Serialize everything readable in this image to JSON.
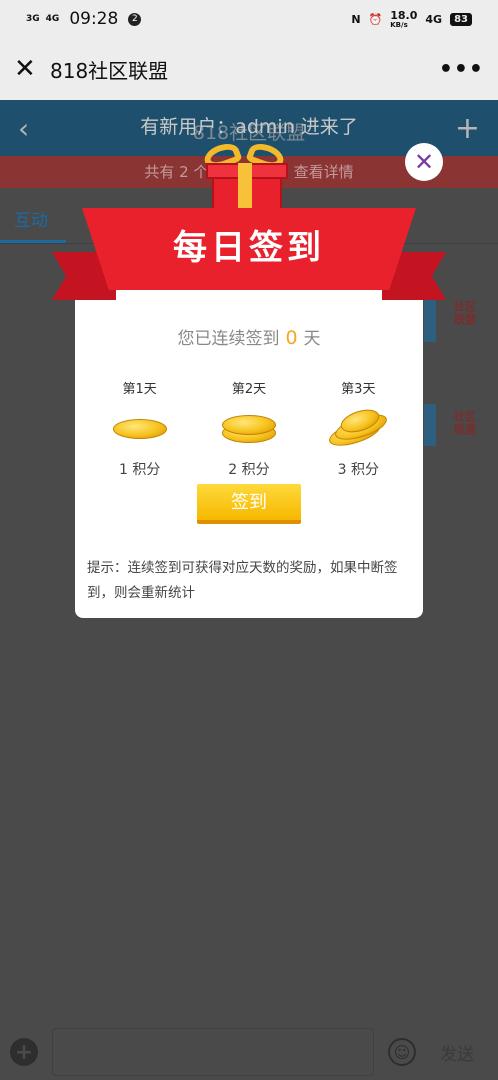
{
  "status_bar": {
    "signal_1": "3G",
    "signal_2": "4G",
    "time": "09:28",
    "notification_count": "2",
    "speed": "18.0",
    "speed_unit": "KB/s",
    "network": "4G",
    "battery": "83"
  },
  "title_bar": {
    "close_glyph": "✕",
    "title": "818社区联盟",
    "more_glyph": "•••"
  },
  "page": {
    "back_glyph": "‹",
    "header_title": "818社区联盟",
    "notice": "有新用户：admin 进来了",
    "plus_glyph": "+",
    "online_banner": "共有 2 个访客，1 人! 查看详情",
    "tab_label": "互动",
    "badge_1": "社区联盟",
    "badge_2": "社区联盟",
    "send_label": "发送"
  },
  "modal": {
    "close_glyph": "✕",
    "title": "每日签到",
    "streak_prefix": "您已连续签到",
    "streak_days": "0",
    "streak_suffix": "天",
    "days": [
      {
        "label": "第1天",
        "points": "1 积分"
      },
      {
        "label": "第2天",
        "points": "2 积分"
      },
      {
        "label": "第3天",
        "points": "3 积分"
      }
    ],
    "button_label": "签到",
    "tip": "提示：连续签到可获得对应天数的奖励，如果中断签到，则会重新统计"
  },
  "colors": {
    "banner_red": "#e8212d",
    "streak_orange": "#f6a623",
    "button_yellow": "#ffd93b",
    "close_purple": "#7b3aa0"
  }
}
